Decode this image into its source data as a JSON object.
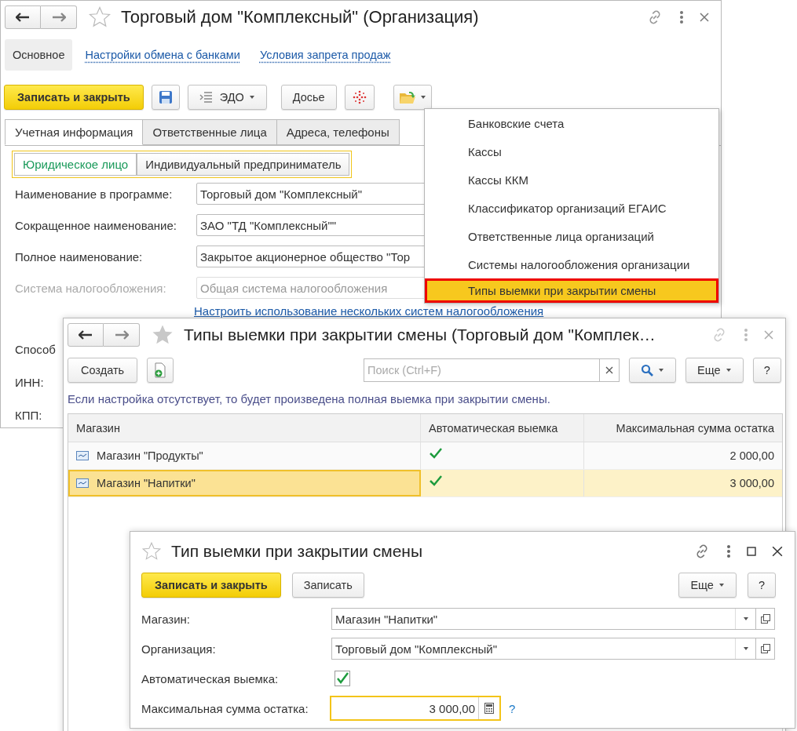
{
  "org_window": {
    "title": "Торговый дом \"Комплексный\" (Организация)",
    "sections": [
      {
        "label": "Основное",
        "selected": true
      },
      {
        "label": "Настройки обмена с банками",
        "selected": false
      },
      {
        "label": "Условия запрета продаж",
        "selected": false
      }
    ],
    "toolbar": {
      "save_close": "Записать и закрыть",
      "edo": "ЭДО",
      "dossier": "Досье"
    },
    "tabs": [
      {
        "label": "Учетная информация",
        "selected": true
      },
      {
        "label": "Ответственные лица",
        "selected": false
      },
      {
        "label": "Адреса, телефоны",
        "selected": false
      }
    ],
    "legal_forms": [
      {
        "label": "Юридическое лицо",
        "selected": true
      },
      {
        "label": "Индивидуальный предприниматель",
        "selected": false
      }
    ],
    "fields": [
      {
        "label": "Наименование в программе:",
        "value": "Торговый дом \"Комплексный\"",
        "disabled": false
      },
      {
        "label": "Сокращенное наименование:",
        "value": "ЗАО \"ТД \"Комплексный\"\"",
        "disabled": false
      },
      {
        "label": "Полное наименование:",
        "value": "Закрытое акционерное общество \"Тор",
        "disabled": false
      },
      {
        "label": "Система налогообложения:",
        "value": "Общая система налогообложения",
        "disabled": true
      }
    ],
    "tax_link": "Настроить использование нескольких систем налогообложения",
    "more_labels": [
      "Способ",
      "ИНН:",
      "КПП:"
    ]
  },
  "menu": {
    "items": [
      {
        "label": "Банковские счета",
        "selected": false
      },
      {
        "label": "Кассы",
        "selected": false
      },
      {
        "label": "Кассы ККМ",
        "selected": false
      },
      {
        "label": "Классификатор организаций ЕГАИС",
        "selected": false
      },
      {
        "label": "Ответственные лица организаций",
        "selected": false
      },
      {
        "label": "Системы налогообложения организации",
        "selected": false
      },
      {
        "label": "Типы выемки при закрытии смены",
        "selected": true
      }
    ]
  },
  "list_window": {
    "title": "Типы выемки при закрытии смены (Торговый дом \"Комплек…",
    "create_button": "Создать",
    "search": {
      "placeholder": "Поиск (Ctrl+F)"
    },
    "more_button": "Еще",
    "help_button": "?",
    "hint": "Если настройка отсутствует, то будет произведена полная выемка при закрытии смены.",
    "table": {
      "columns": [
        "Магазин",
        "Автоматическая выемка",
        "Максимальная сумма остатка"
      ],
      "rows": [
        {
          "store": "Магазин \"Продукты\"",
          "auto": true,
          "max_sum": "2 000,00",
          "selected": false
        },
        {
          "store": "Магазин \"Напитки\"",
          "auto": true,
          "max_sum": "3 000,00",
          "selected": true
        }
      ]
    }
  },
  "form_window": {
    "title": "Тип выемки при закрытии смены",
    "save_close": "Записать и закрыть",
    "save": "Записать",
    "more_button": "Еще",
    "help_button": "?",
    "fields": [
      {
        "kind": "select",
        "label": "Магазин:",
        "value": "Магазин \"Напитки\""
      },
      {
        "kind": "select",
        "label": "Организация:",
        "value": "Торговый дом \"Комплексный\""
      },
      {
        "kind": "checkbox",
        "label": "Автоматическая выемка:",
        "checked": true
      },
      {
        "kind": "number",
        "label": "Максимальная сумма остатка:",
        "value": "3 000,00",
        "focused": true,
        "help": "?"
      }
    ]
  }
}
